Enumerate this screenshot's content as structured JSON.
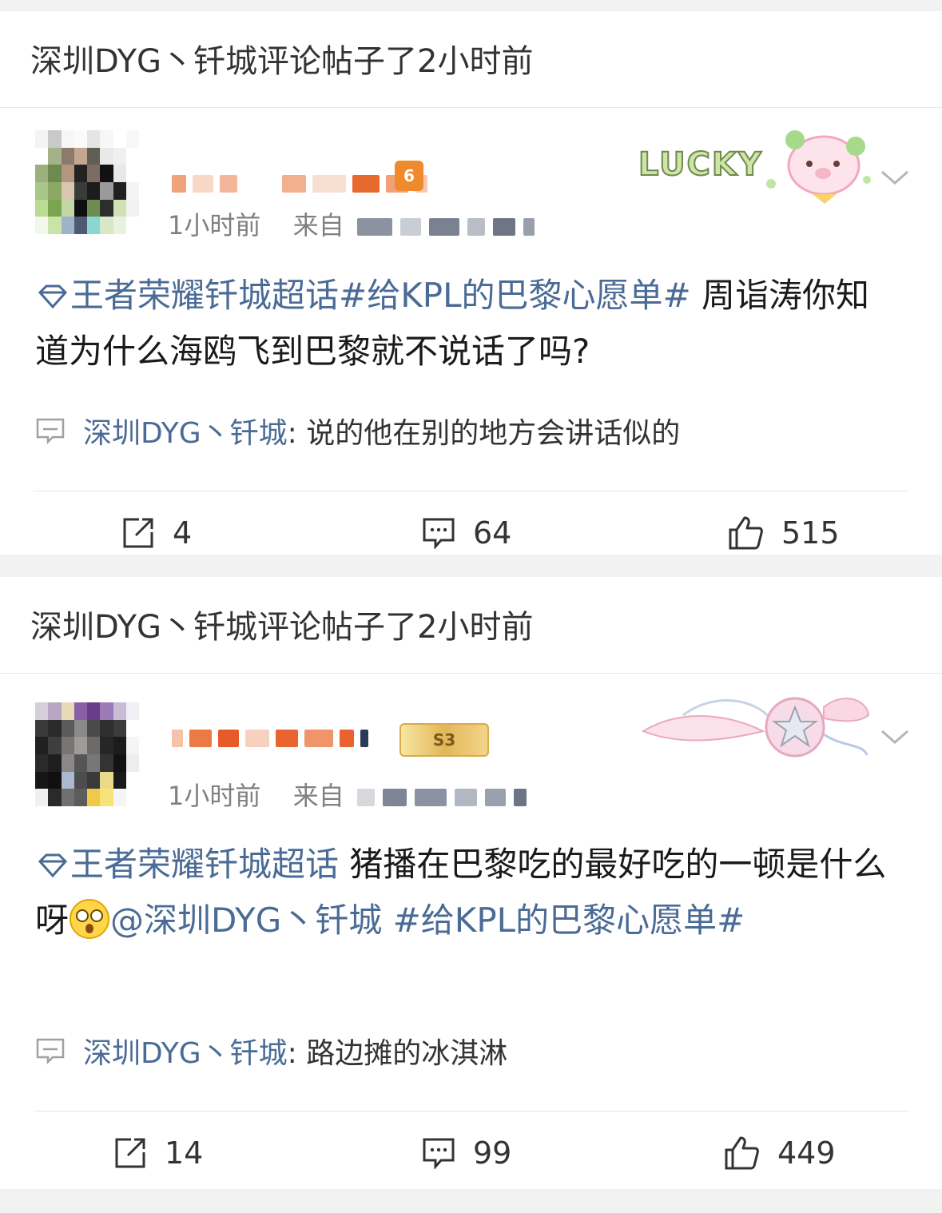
{
  "posts": [
    {
      "header": "深圳DYG丶钎城评论帖子了2小时前",
      "time": "1小时前",
      "from_label": "来自",
      "level_badge": "6",
      "decor_text": "LUCKY",
      "content": {
        "topic": "王者荣耀钎城超话",
        "hashtag": "#给KPL的巴黎心愿单#",
        "text": " 周诣涛你知道为什么海鸥飞到巴黎就不说话了吗?"
      },
      "comment": {
        "user": "深圳DYG丶钎城",
        "text": ": 说的他在别的地方会讲话似的"
      },
      "stats": {
        "reposts": "4",
        "comments": "64",
        "likes": "515"
      }
    },
    {
      "header": "深圳DYG丶钎城评论帖子了2小时前",
      "time": "1小时前",
      "from_label": "来自",
      "level_badge": "S3",
      "content": {
        "topic": "王者荣耀钎城超话",
        "text": "  猪播在巴黎吃的最好吃的一顿是什么呀",
        "mention": "@深圳DYG丶钎城",
        "hashtag": " #给KPL的巴黎心愿单#"
      },
      "comment": {
        "user": "深圳DYG丶钎城",
        "text": ": 路边摊的冰淇淋"
      },
      "stats": {
        "reposts": "14",
        "comments": "99",
        "likes": "449"
      }
    }
  ],
  "colors": {
    "link": "#4a6b95",
    "muted": "#808080",
    "text": "#1a1a1a",
    "divider": "#e6e6e6"
  }
}
